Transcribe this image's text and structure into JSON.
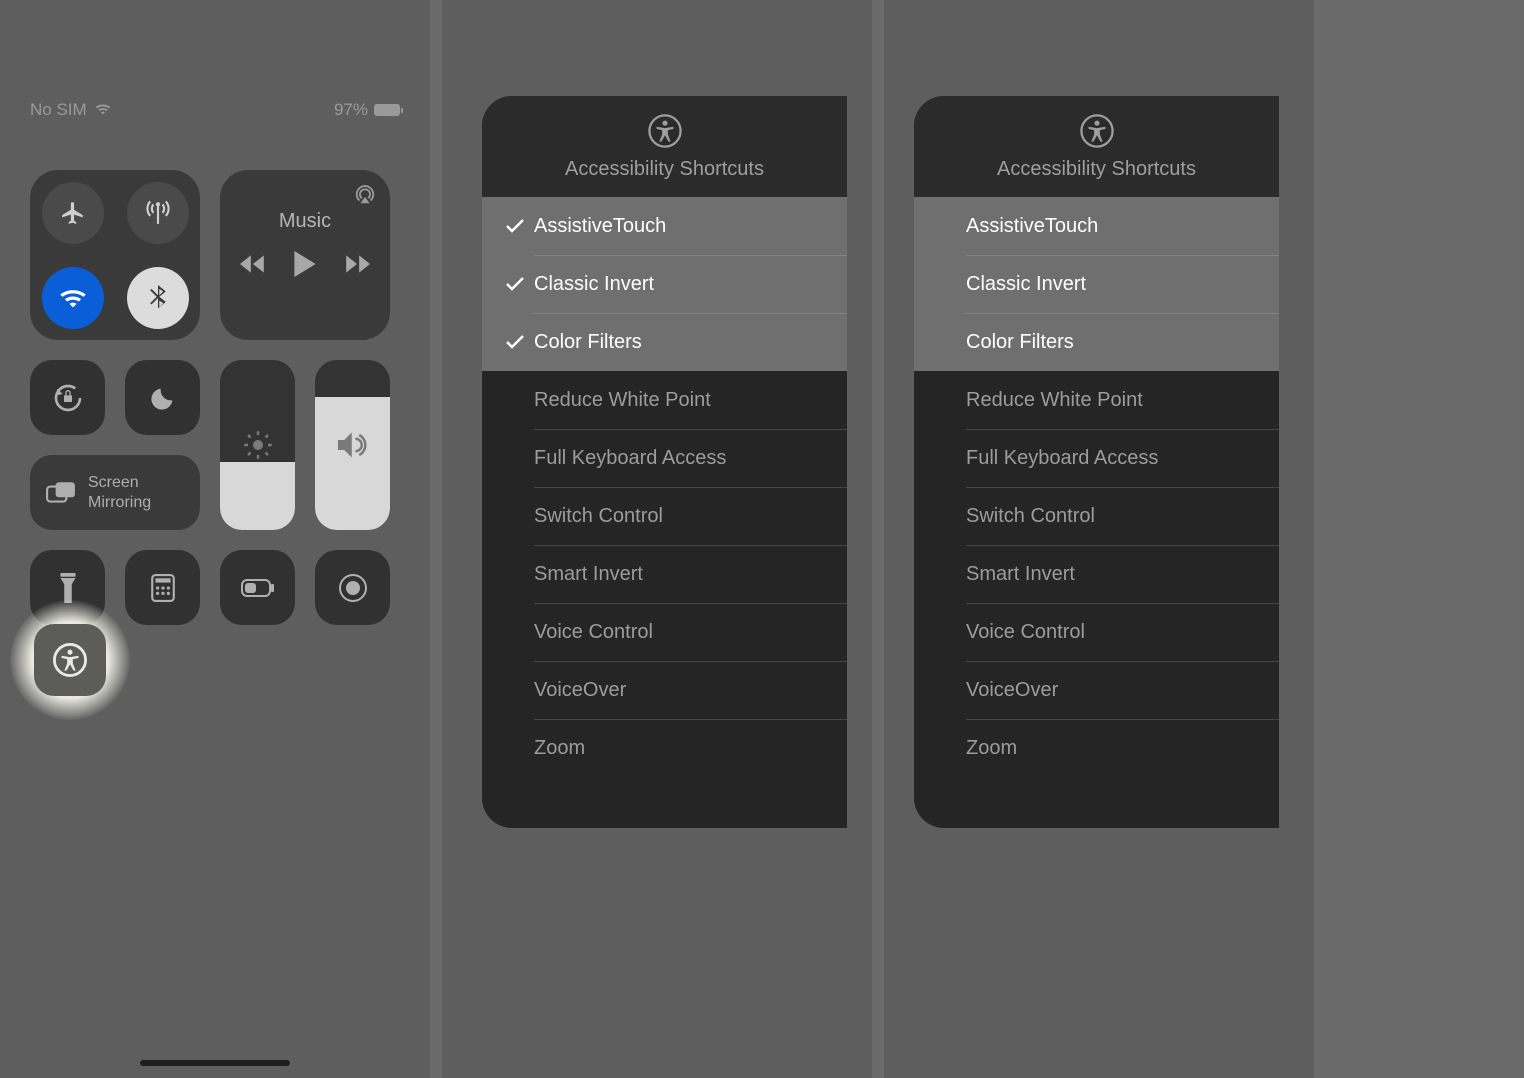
{
  "panel1": {
    "status": {
      "left_text": "No SIM",
      "battery_pct": "97%"
    },
    "music": {
      "label": "Music"
    },
    "mirror": {
      "line1": "Screen",
      "line2": "Mirroring"
    }
  },
  "shortcuts": {
    "header_title": "Accessibility Shortcuts",
    "items": [
      {
        "label": "AssistiveTouch",
        "enabled": true
      },
      {
        "label": "Classic Invert",
        "enabled": true
      },
      {
        "label": "Color Filters",
        "enabled": true
      },
      {
        "label": "Reduce White Point",
        "enabled": false
      },
      {
        "label": "Full Keyboard Access",
        "enabled": false
      },
      {
        "label": "Switch Control",
        "enabled": false
      },
      {
        "label": "Smart Invert",
        "enabled": false
      },
      {
        "label": "Voice Control",
        "enabled": false
      },
      {
        "label": "VoiceOver",
        "enabled": false
      },
      {
        "label": "Zoom",
        "enabled": false
      }
    ]
  },
  "panel2_shows_checks": true,
  "panel3_shows_checks": false
}
